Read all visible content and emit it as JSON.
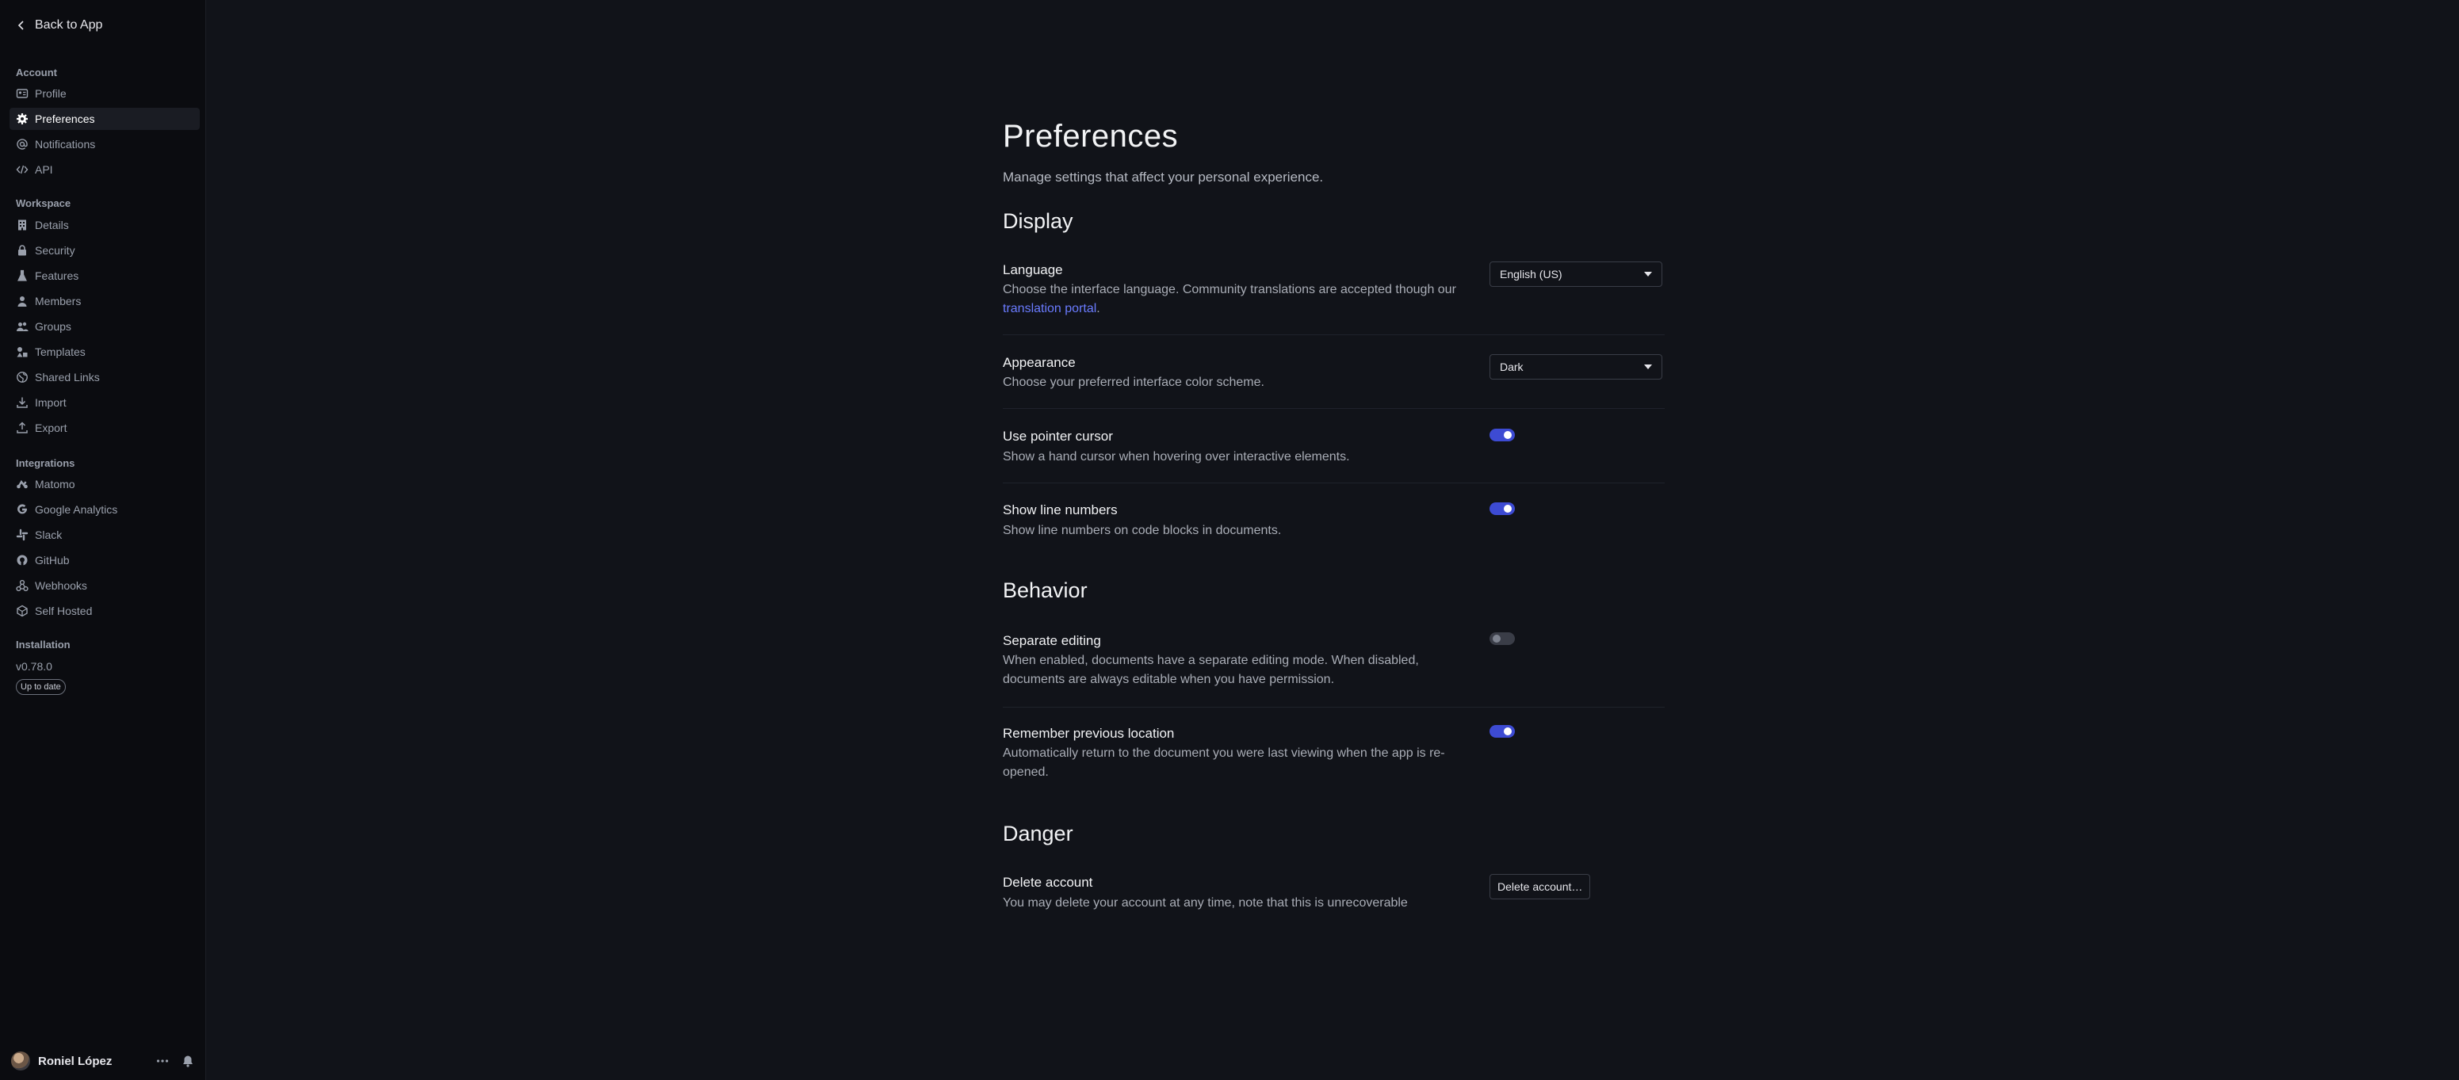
{
  "sidebar": {
    "back_label": "Back to App",
    "sections": [
      {
        "title": "Account",
        "items": [
          {
            "label": "Profile",
            "icon": "profile-card-icon"
          },
          {
            "label": "Preferences",
            "icon": "gear-icon",
            "active": true
          },
          {
            "label": "Notifications",
            "icon": "at-sign-icon"
          },
          {
            "label": "API",
            "icon": "code-icon"
          }
        ]
      },
      {
        "title": "Workspace",
        "items": [
          {
            "label": "Details",
            "icon": "building-icon"
          },
          {
            "label": "Security",
            "icon": "lock-icon"
          },
          {
            "label": "Features",
            "icon": "flask-icon"
          },
          {
            "label": "Members",
            "icon": "user-icon"
          },
          {
            "label": "Groups",
            "icon": "group-icon"
          },
          {
            "label": "Templates",
            "icon": "shapes-icon"
          },
          {
            "label": "Shared Links",
            "icon": "globe-icon"
          },
          {
            "label": "Import",
            "icon": "import-icon"
          },
          {
            "label": "Export",
            "icon": "export-icon"
          }
        ]
      },
      {
        "title": "Integrations",
        "items": [
          {
            "label": "Matomo",
            "icon": "matomo-icon"
          },
          {
            "label": "Google Analytics",
            "icon": "google-icon"
          },
          {
            "label": "Slack",
            "icon": "slack-icon"
          },
          {
            "label": "GitHub",
            "icon": "github-icon"
          },
          {
            "label": "Webhooks",
            "icon": "webhooks-icon"
          },
          {
            "label": "Self Hosted",
            "icon": "self-hosted-icon"
          }
        ]
      },
      {
        "title": "Installation",
        "items": []
      }
    ],
    "version": "v0.78.0",
    "update_badge": "Up to date",
    "user_name": "Roniel López"
  },
  "main": {
    "title": "Preferences",
    "subtitle": "Manage settings that affect your personal experience.",
    "display": {
      "heading": "Display",
      "language": {
        "title": "Language",
        "desc_before": "Choose the interface language. Community translations are accepted though our ",
        "desc_link": "translation portal",
        "desc_after": ".",
        "value": "English (US)"
      },
      "appearance": {
        "title": "Appearance",
        "desc": "Choose your preferred interface color scheme.",
        "value": "Dark"
      },
      "pointer": {
        "title": "Use pointer cursor",
        "desc": "Show a hand cursor when hovering over interactive elements.",
        "enabled": true
      },
      "line_numbers": {
        "title": "Show line numbers",
        "desc": "Show line numbers on code blocks in documents.",
        "enabled": true
      }
    },
    "behavior": {
      "heading": "Behavior",
      "separate_editing": {
        "title": "Separate editing",
        "desc": "When enabled, documents have a separate editing mode. When disabled, documents are always editable when you have permission.",
        "enabled": false
      },
      "remember_location": {
        "title": "Remember previous location",
        "desc": "Automatically return to the document you were last viewing when the app is re-opened.",
        "enabled": true
      }
    },
    "danger": {
      "heading": "Danger",
      "delete": {
        "title": "Delete account",
        "desc": "You may delete your account at any time, note that this is unrecoverable",
        "button": "Delete account…"
      }
    }
  },
  "colors": {
    "background": "#111319",
    "sidebar": "#0b0c10",
    "accent": "#3d4bd3",
    "link": "#6a7bff"
  }
}
